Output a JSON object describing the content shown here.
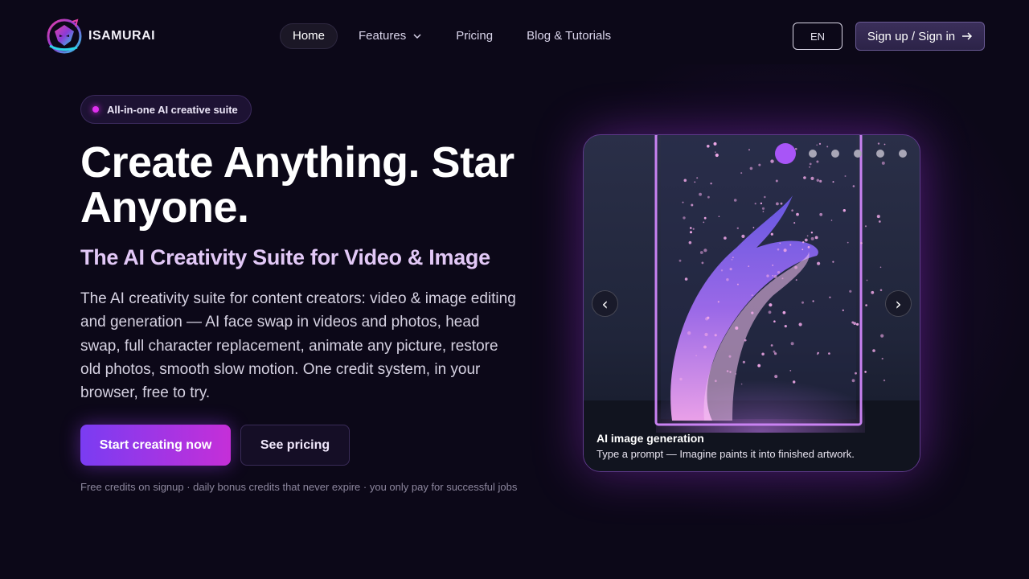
{
  "brand": {
    "name": "ISAMURAI"
  },
  "nav": {
    "items": [
      {
        "label": "Home",
        "active": true
      },
      {
        "label": "Features",
        "has_dropdown": true
      },
      {
        "label": "Pricing"
      },
      {
        "label": "Blog & Tutorials"
      }
    ],
    "language": "EN",
    "signup_label": "Sign up / Sign in"
  },
  "hero": {
    "badge": "All-in-one AI creative suite",
    "title": "Create Anything. Star Anyone.",
    "subtitle": "The AI Creativity Suite for Video & Image",
    "description": "The AI creativity suite for content creators: video & image editing and generation — AI face swap in videos and photos, head swap, full character replacement, animate any picture, restore old photos, smooth slow motion. One credit system, in your browser, free to try.",
    "cta_primary": "Start creating now",
    "cta_secondary": "See pricing",
    "footnote": "Free credits on signup · daily bonus credits that never expire · you only pay for successful jobs"
  },
  "carousel": {
    "slide_count": 6,
    "active_index": 0,
    "prev_glyph": "‹",
    "next_glyph": "›",
    "caption_title": "AI image generation",
    "caption_text": "Type a prompt — Imagine paints it into finished artwork."
  },
  "colors": {
    "background": "#0c0818",
    "accent_purple": "#a855f7",
    "cta_gradient_start": "#7a3cf2",
    "cta_gradient_end": "#c52fd8",
    "subtitle": "#e2c8f6"
  },
  "icons": {
    "logo": "samurai-mask-logo",
    "features_dropdown": "chevron-down-icon",
    "signup_arrow": "arrow-right-icon"
  }
}
